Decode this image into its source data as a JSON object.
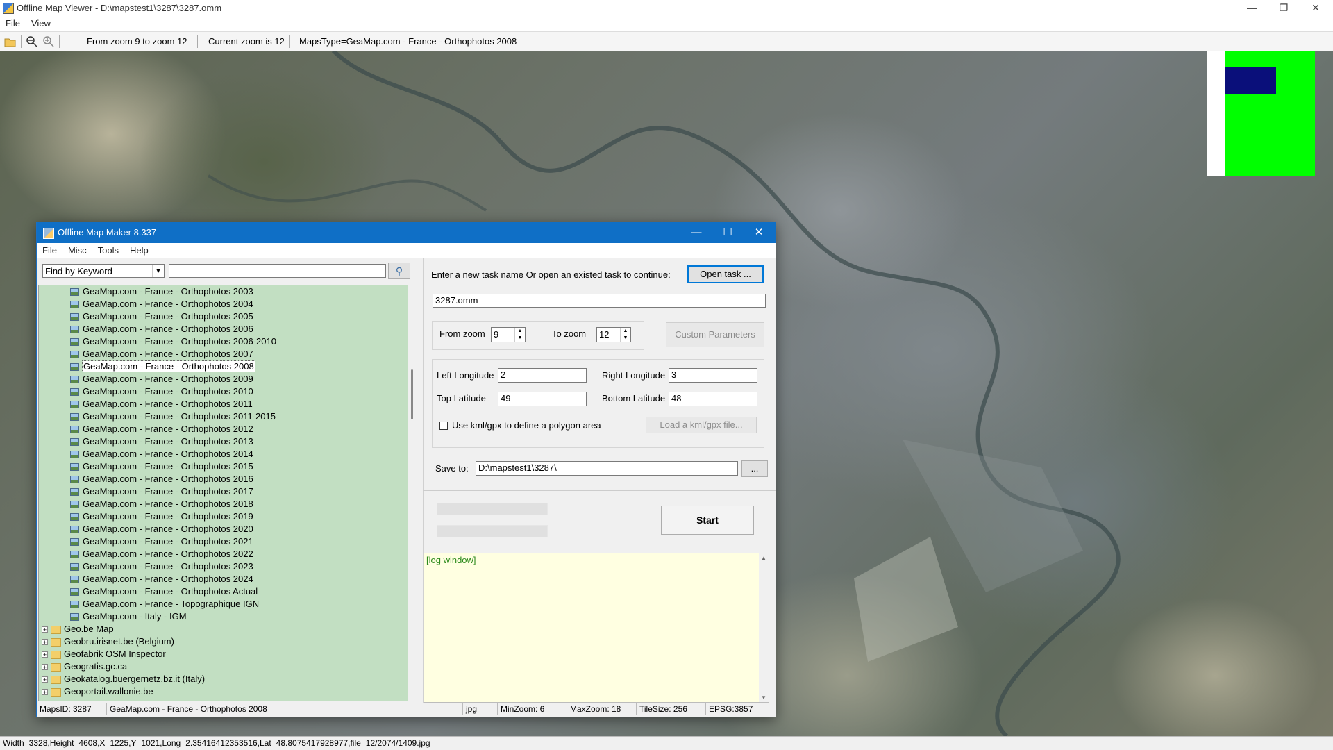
{
  "viewer": {
    "title": "Offline Map Viewer - D:\\mapstest1\\3287\\3287.omm",
    "menu": [
      "File",
      "View"
    ],
    "toolbar": {
      "zoom_range": "From zoom 9 to zoom 12",
      "current_zoom": "Current zoom is 12",
      "maps_type": "MapsType=GeaMap.com - France - Orthophotos 2008"
    },
    "status": "Width=3328,Height=4608,X=1225,Y=1021,Long=2.35416412353516,Lat=48.8075417928977,file=12/2074/1409.jpg"
  },
  "dialog": {
    "title": "Offline Map Maker 8.337",
    "menu": [
      "File",
      "Misc",
      "Tools",
      "Help"
    ],
    "search": {
      "mode": "Find by Keyword",
      "query": ""
    },
    "tree": {
      "items": [
        "GeaMap.com - France - Orthophotos 2003",
        "GeaMap.com - France - Orthophotos 2004",
        "GeaMap.com - France - Orthophotos 2005",
        "GeaMap.com - France - Orthophotos 2006",
        "GeaMap.com - France - Orthophotos 2006-2010",
        "GeaMap.com - France - Orthophotos 2007",
        "GeaMap.com - France - Orthophotos 2008",
        "GeaMap.com - France - Orthophotos 2009",
        "GeaMap.com - France - Orthophotos 2010",
        "GeaMap.com - France - Orthophotos 2011",
        "GeaMap.com - France - Orthophotos 2011-2015",
        "GeaMap.com - France - Orthophotos 2012",
        "GeaMap.com - France - Orthophotos 2013",
        "GeaMap.com - France - Orthophotos 2014",
        "GeaMap.com - France - Orthophotos 2015",
        "GeaMap.com - France - Orthophotos 2016",
        "GeaMap.com - France - Orthophotos 2017",
        "GeaMap.com - France - Orthophotos 2018",
        "GeaMap.com - France - Orthophotos 2019",
        "GeaMap.com - France - Orthophotos 2020",
        "GeaMap.com - France - Orthophotos 2021",
        "GeaMap.com - France - Orthophotos 2022",
        "GeaMap.com - France - Orthophotos 2023",
        "GeaMap.com - France - Orthophotos 2024",
        "GeaMap.com - France - Orthophotos Actual",
        "GeaMap.com - France - Topographique IGN",
        "GeaMap.com - Italy - IGM"
      ],
      "selected": "GeaMap.com - France - Orthophotos 2008",
      "folders": [
        "Geo.be Map",
        "Geobru.irisnet.be (Belgium)",
        "Geofabrik OSM Inspector",
        "Geogratis.gc.ca",
        "Geokatalog.buergernetz.bz.it (Italy)",
        "Geoportail.wallonie.be"
      ]
    },
    "task": {
      "prompt": "Enter a new task name Or open an existed task to continue:",
      "open_button": "Open task ...",
      "name": "3287.omm"
    },
    "zoom": {
      "from_label": "From zoom",
      "from_value": "9",
      "to_label": "To zoom",
      "to_value": "12",
      "custom_button": "Custom Parameters"
    },
    "coords": {
      "left_lon_label": "Left Longitude",
      "left_lon": "2",
      "right_lon_label": "Right Longitude",
      "right_lon": "3",
      "top_lat_label": "Top Latitude",
      "top_lat": "49",
      "bottom_lat_label": "Bottom Latitude",
      "bottom_lat": "48",
      "kml_label": "Use kml/gpx to define a polygon area",
      "kml_button": "Load a kml/gpx file..."
    },
    "save": {
      "label": "Save to:",
      "path": "D:\\mapstest1\\3287\\",
      "browse": "..."
    },
    "start_button": "Start",
    "log": "[log window]",
    "status": {
      "maps_id": "MapsID: 3287",
      "map_name": "GeaMap.com - France - Orthophotos 2008",
      "format": "jpg",
      "min_zoom": "MinZoom: 6",
      "max_zoom": "MaxZoom: 18",
      "tile_size": "TileSize: 256",
      "epsg": "EPSG:3857"
    }
  }
}
